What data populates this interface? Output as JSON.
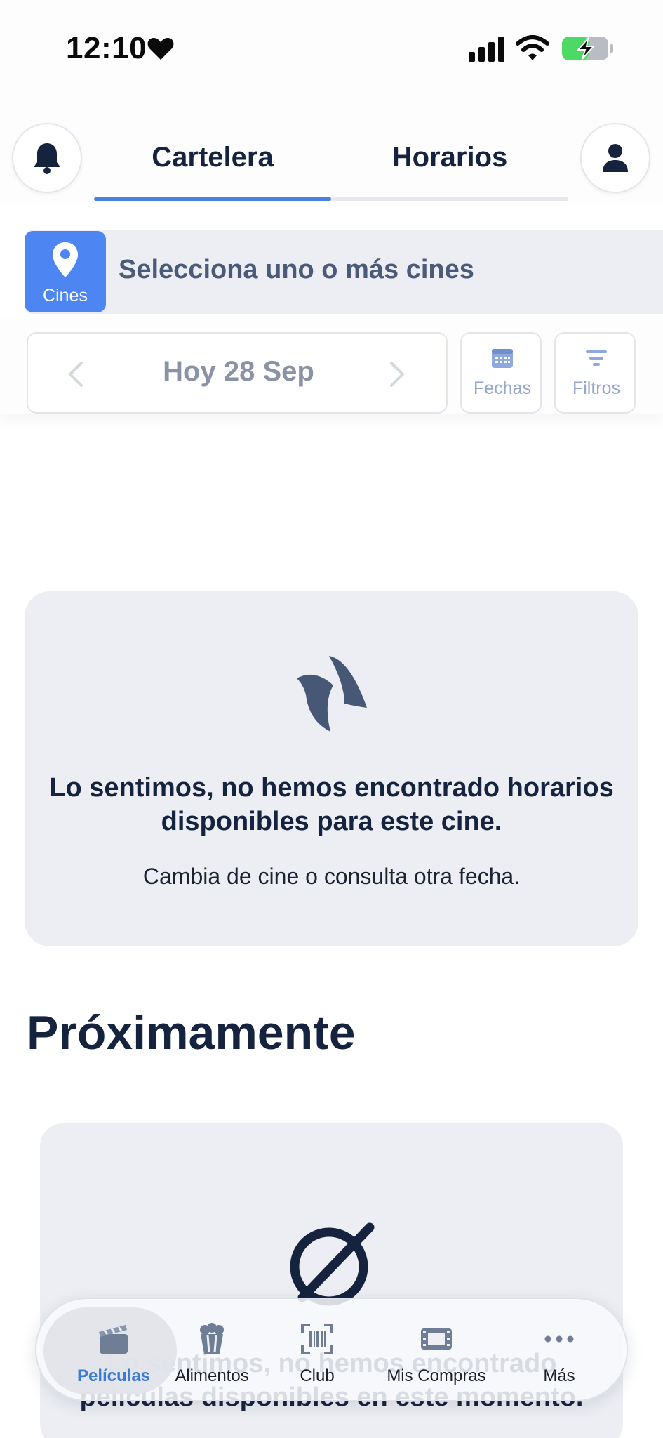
{
  "status_bar": {
    "time": "12:10",
    "icons": [
      "heart-icon",
      "signal-icon",
      "wifi-icon",
      "battery-charging-icon"
    ]
  },
  "header": {
    "left_icon": "bell-icon",
    "right_icon": "user-icon",
    "tabs": [
      {
        "label": "Cartelera",
        "active": true
      },
      {
        "label": "Horarios",
        "active": false
      }
    ],
    "accent_color": "#4a7fdc"
  },
  "cinema_selector": {
    "button_label": "Cines",
    "button_icon": "location-pin-icon",
    "prompt": "Selecciona uno o más cines",
    "button_color": "#4d85f2"
  },
  "date_bar": {
    "current_date": "Hoy 28 Sep",
    "fechas_label": "Fechas",
    "filtros_label": "Filtros"
  },
  "empty_state": {
    "icon": "brand-logo-icon",
    "title": "Lo sentimos, no hemos encontrado horarios disponibles para este cine.",
    "subtitle": "Cambia de cine o consulta otra fecha."
  },
  "coming_soon": {
    "title": "Próximamente",
    "icon": "no-entry-icon",
    "message": "Lo sentimos, no hemos encontrado películas disponibles en este momento."
  },
  "bottom_nav": {
    "items": [
      {
        "label": "Películas",
        "icon": "clapperboard-icon",
        "active": true
      },
      {
        "label": "Alimentos",
        "icon": "popcorn-icon",
        "active": false
      },
      {
        "label": "Club",
        "icon": "barcode-scan-icon",
        "active": false
      },
      {
        "label": "Mis Compras",
        "icon": "ticket-icon",
        "active": false
      },
      {
        "label": "Más",
        "icon": "more-dots-icon",
        "active": false
      }
    ]
  }
}
